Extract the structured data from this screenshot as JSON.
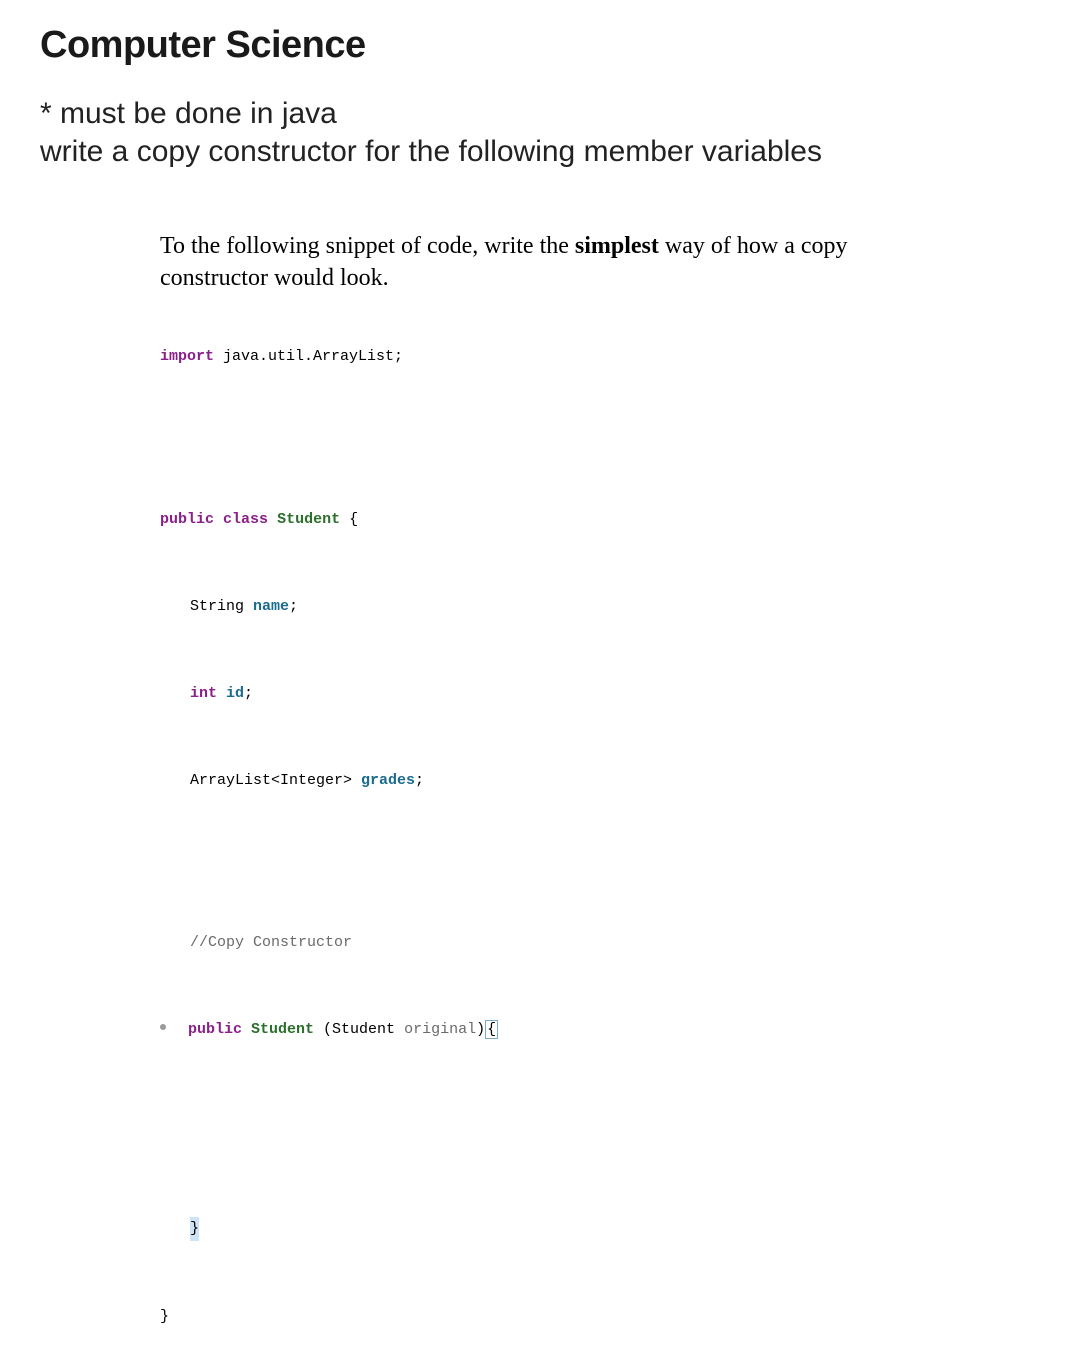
{
  "title": "Computer Science",
  "prompt": {
    "line1": "* must be done in java",
    "line2": "write a copy constructor for the following member variables"
  },
  "instruction": {
    "prefix": "To the following snippet of code, write the ",
    "bold": "simplest",
    "suffix": " way of how a copy constructor would look."
  },
  "code": {
    "import_kw": "import",
    "import_rest": " java.util.ArrayList;",
    "public_kw": "public",
    "class_kw": "class",
    "student_cls": "Student",
    "open_brace": " {",
    "field_name_type": "String ",
    "field_name_var": "name",
    "semi": ";",
    "int_kw": "int",
    "space": " ",
    "field_id_var": "id",
    "arraylist_type": "ArrayList<Integer> ",
    "field_grades_var": "grades",
    "comment": "//Copy Constructor",
    "ctor_public": "public",
    "ctor_cls": "Student",
    "ctor_open": " (Student ",
    "ctor_arg": "original",
    "ctor_close": ")",
    "ctor_brace": "{",
    "close_inner": "}",
    "close_outer": "}"
  }
}
